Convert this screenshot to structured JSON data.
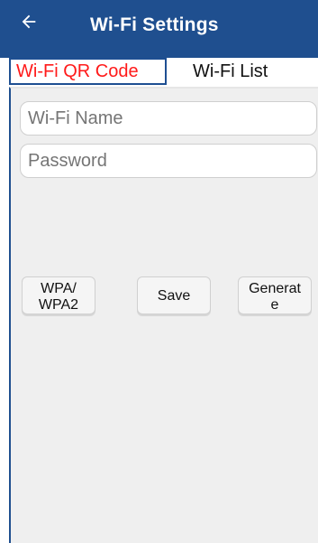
{
  "header": {
    "title": "Wi-Fi Settings",
    "icons": {
      "back": "back-arrow-icon"
    },
    "colors": {
      "background": "#1f4f8f",
      "text": "#ffffff"
    }
  },
  "tabs": [
    {
      "label": "Wi-Fi QR Code",
      "active": true,
      "color": "#ff1a1a"
    },
    {
      "label": "Wi-Fi List",
      "active": false
    }
  ],
  "form": {
    "wifi_name_placeholder": "Wi-Fi Name",
    "password_placeholder": "Password"
  },
  "buttons": {
    "security_label": "WPA/\nWPA2",
    "save_label": "Save",
    "generate_label": "Generat\ne"
  }
}
